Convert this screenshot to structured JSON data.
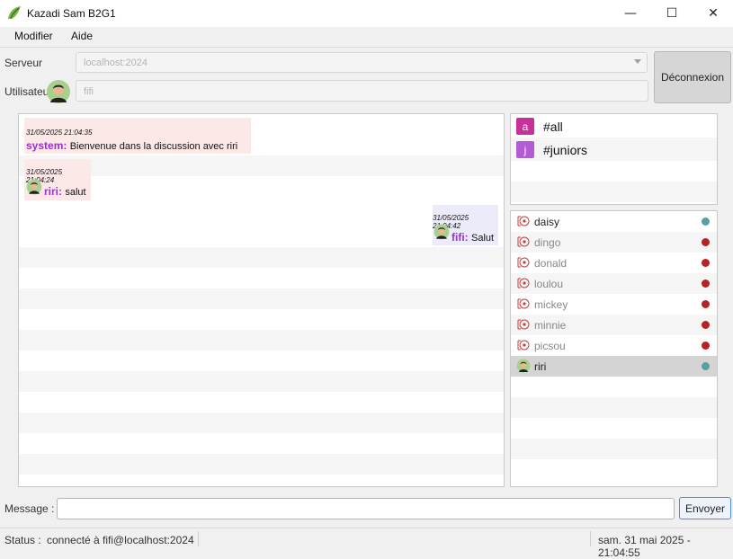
{
  "window": {
    "title": "Kazadi Sam B2G1",
    "minimize_glyph": "—",
    "maximize_glyph": "☐",
    "close_glyph": "✕"
  },
  "menu": {
    "items": [
      {
        "label": "Modifier"
      },
      {
        "label": "Aide"
      }
    ]
  },
  "server": {
    "label": "Serveur",
    "value": "localhost:2024"
  },
  "user": {
    "label": "Utilisateur",
    "value": "fifi"
  },
  "disconnect_label": "Déconnexion",
  "messages": [
    {
      "timestamp": "31/05/2025 21:04:35",
      "author": "system:",
      "text": "Bienvenue dans la discussion avec riri",
      "align": "left",
      "avatar": false,
      "author_color": "#9b30d0",
      "bg": "#fde8e8"
    },
    {
      "timestamp": "31/05/2025 21:04:24",
      "author": "riri:",
      "text": "salut",
      "align": "left",
      "avatar": true,
      "author_color": "#9b30d0",
      "bg": "#fde8e8"
    },
    {
      "timestamp": "31/05/2025 21:04:42",
      "author": "fifi:",
      "text": "Salut",
      "align": "right",
      "avatar": true,
      "author_color": "#9b30d0",
      "bg": "#ecebfa"
    }
  ],
  "channels": [
    {
      "letter": "a",
      "name": "#all",
      "color": "#c8309a"
    },
    {
      "letter": "j",
      "name": "#juniors",
      "color": "#b35ad4"
    }
  ],
  "users": [
    {
      "name": "daisy",
      "status": "online",
      "dot_color": "#5a9ea0",
      "text_color": "#222",
      "icon": "offline-user-icon",
      "selected": false
    },
    {
      "name": "dingo",
      "status": "offline",
      "dot_color": "#b52424",
      "text_color": "#888",
      "icon": "offline-user-icon",
      "selected": false
    },
    {
      "name": "donald",
      "status": "offline",
      "dot_color": "#b52424",
      "text_color": "#888",
      "icon": "offline-user-icon",
      "selected": false
    },
    {
      "name": "loulou",
      "status": "offline",
      "dot_color": "#b52424",
      "text_color": "#888",
      "icon": "offline-user-icon",
      "selected": false
    },
    {
      "name": "mickey",
      "status": "offline",
      "dot_color": "#b52424",
      "text_color": "#888",
      "icon": "offline-user-icon",
      "selected": false
    },
    {
      "name": "minnie",
      "status": "offline",
      "dot_color": "#b52424",
      "text_color": "#888",
      "icon": "offline-user-icon",
      "selected": false
    },
    {
      "name": "picsou",
      "status": "offline",
      "dot_color": "#b52424",
      "text_color": "#888",
      "icon": "offline-user-icon",
      "selected": false
    },
    {
      "name": "riri",
      "status": "online",
      "dot_color": "#5a9ea0",
      "text_color": "#222",
      "icon": "avatar-icon",
      "selected": true
    }
  ],
  "composer": {
    "label": "Message :",
    "value": "",
    "send_label": "Envoyer"
  },
  "status": {
    "label": "Status :",
    "text": "connecté à fifi@localhost:2024",
    "datetime": "sam. 31 mai 2025 - 21:04:55"
  }
}
